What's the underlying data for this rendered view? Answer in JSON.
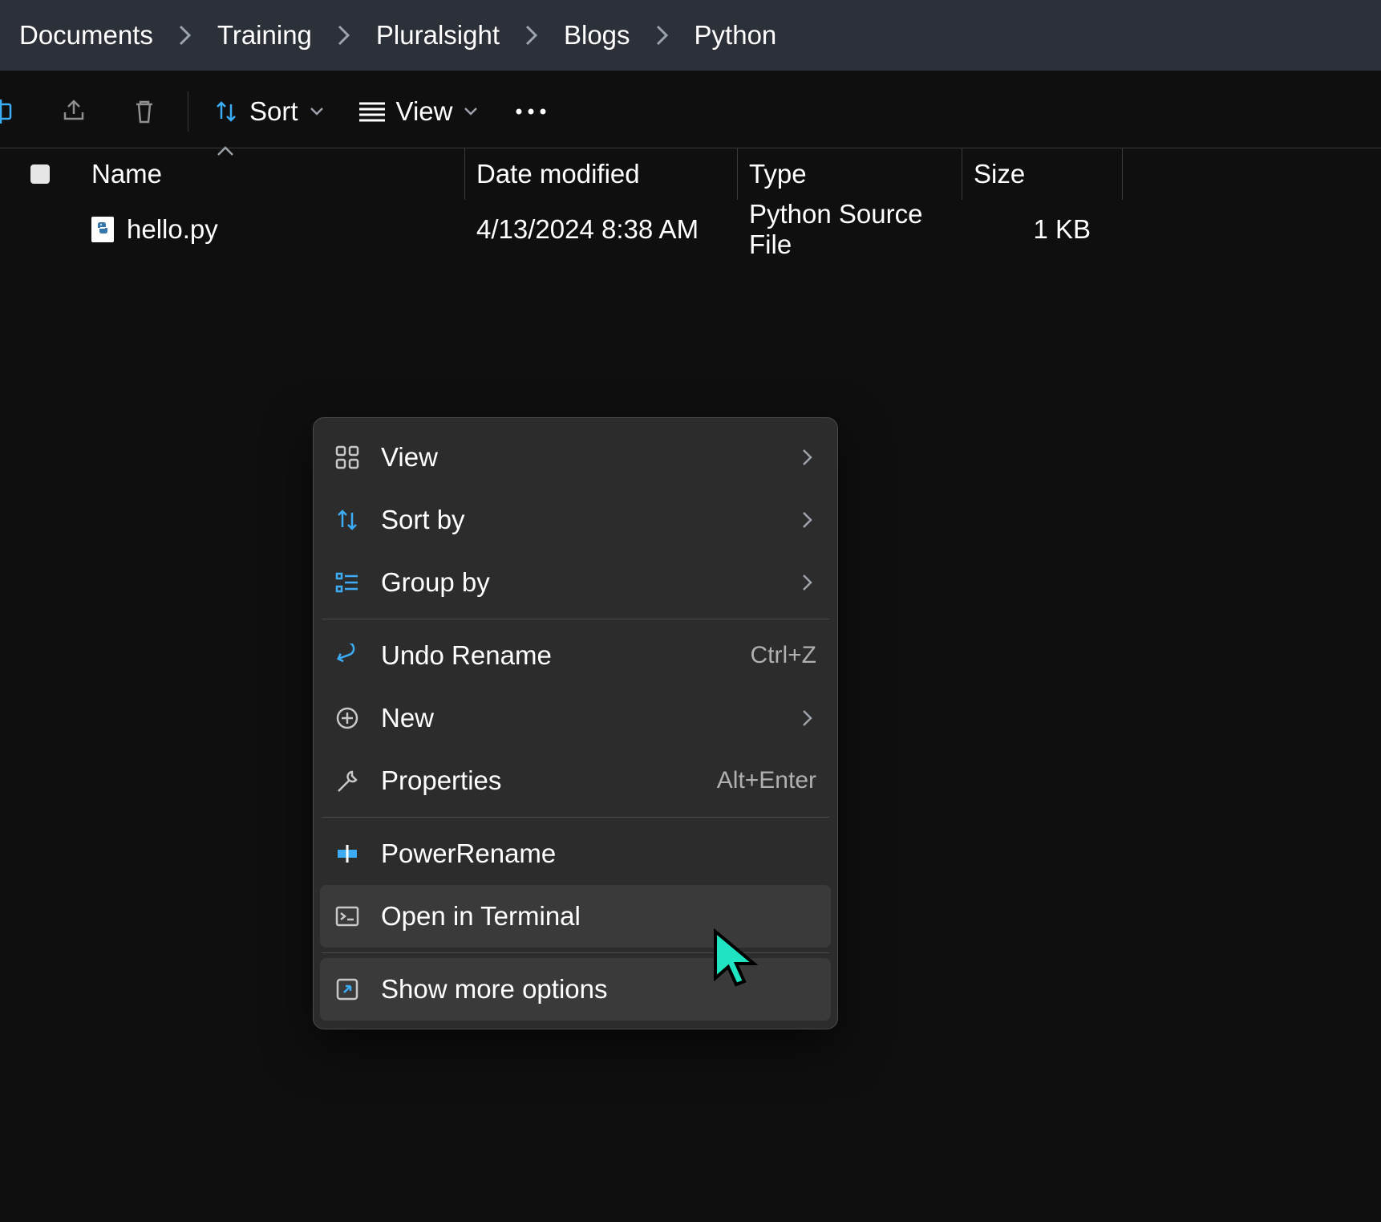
{
  "breadcrumb": [
    "Documents",
    "Training",
    "Pluralsight",
    "Blogs",
    "Python"
  ],
  "toolbar": {
    "sort_label": "Sort",
    "view_label": "View"
  },
  "columns": {
    "name": "Name",
    "date": "Date modified",
    "type": "Type",
    "size": "Size"
  },
  "files": [
    {
      "name": "hello.py",
      "date": "4/13/2024 8:38 AM",
      "type": "Python Source File",
      "size": "1 KB"
    }
  ],
  "context_menu": {
    "view": "View",
    "sort_by": "Sort by",
    "group_by": "Group by",
    "undo_rename": "Undo Rename",
    "undo_rename_shortcut": "Ctrl+Z",
    "new": "New",
    "properties": "Properties",
    "properties_shortcut": "Alt+Enter",
    "power_rename": "PowerRename",
    "open_terminal": "Open in Terminal",
    "show_more": "Show more options"
  }
}
